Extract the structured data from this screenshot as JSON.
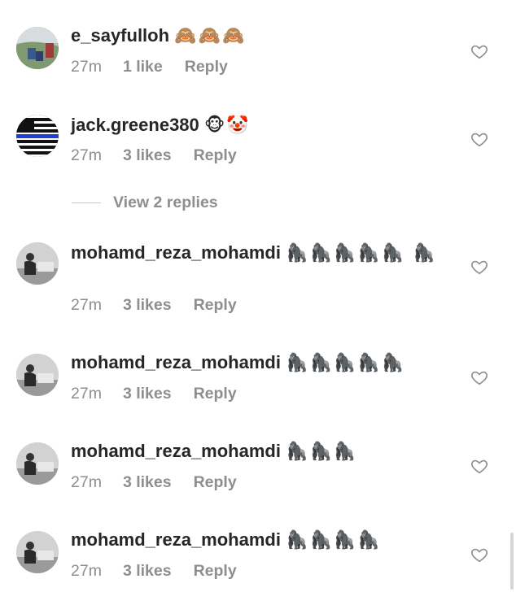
{
  "comments": [
    {
      "username": "e_sayfulloh",
      "emoji": "🙈🙈🙈",
      "time": "27m",
      "likes": "1 like",
      "reply": "Reply",
      "avatar": "photo-outdoor-avatar"
    },
    {
      "username": "jack.greene380",
      "emoji": "🐵🤡",
      "time": "27m",
      "likes": "3 likes",
      "reply": "Reply",
      "avatar": "thin-blue-line-flag-avatar"
    },
    {
      "username": "mohamd_reza_mohamdi",
      "emoji": "🦍🦍🦍🦍🦍 🦍",
      "time": "27m",
      "likes": "3 likes",
      "reply": "Reply",
      "avatar": "grayscale-photo-avatar"
    },
    {
      "username": "mohamd_reza_mohamdi",
      "emoji": "🦍🦍🦍🦍🦍",
      "time": "27m",
      "likes": "3 likes",
      "reply": "Reply",
      "avatar": "grayscale-photo-avatar"
    },
    {
      "username": "mohamd_reza_mohamdi",
      "emoji": "🦍🦍🦍",
      "time": "27m",
      "likes": "3 likes",
      "reply": "Reply",
      "avatar": "grayscale-photo-avatar"
    },
    {
      "username": "mohamd_reza_mohamdi",
      "emoji": "🦍🦍🦍🦍",
      "time": "27m",
      "likes": "3 likes",
      "reply": "Reply",
      "avatar": "grayscale-photo-avatar"
    }
  ],
  "view_replies": "View 2 replies",
  "icons": {
    "like": "heart-outline-icon"
  },
  "colors": {
    "text": "#262626",
    "secondary": "#8e8e8e"
  }
}
